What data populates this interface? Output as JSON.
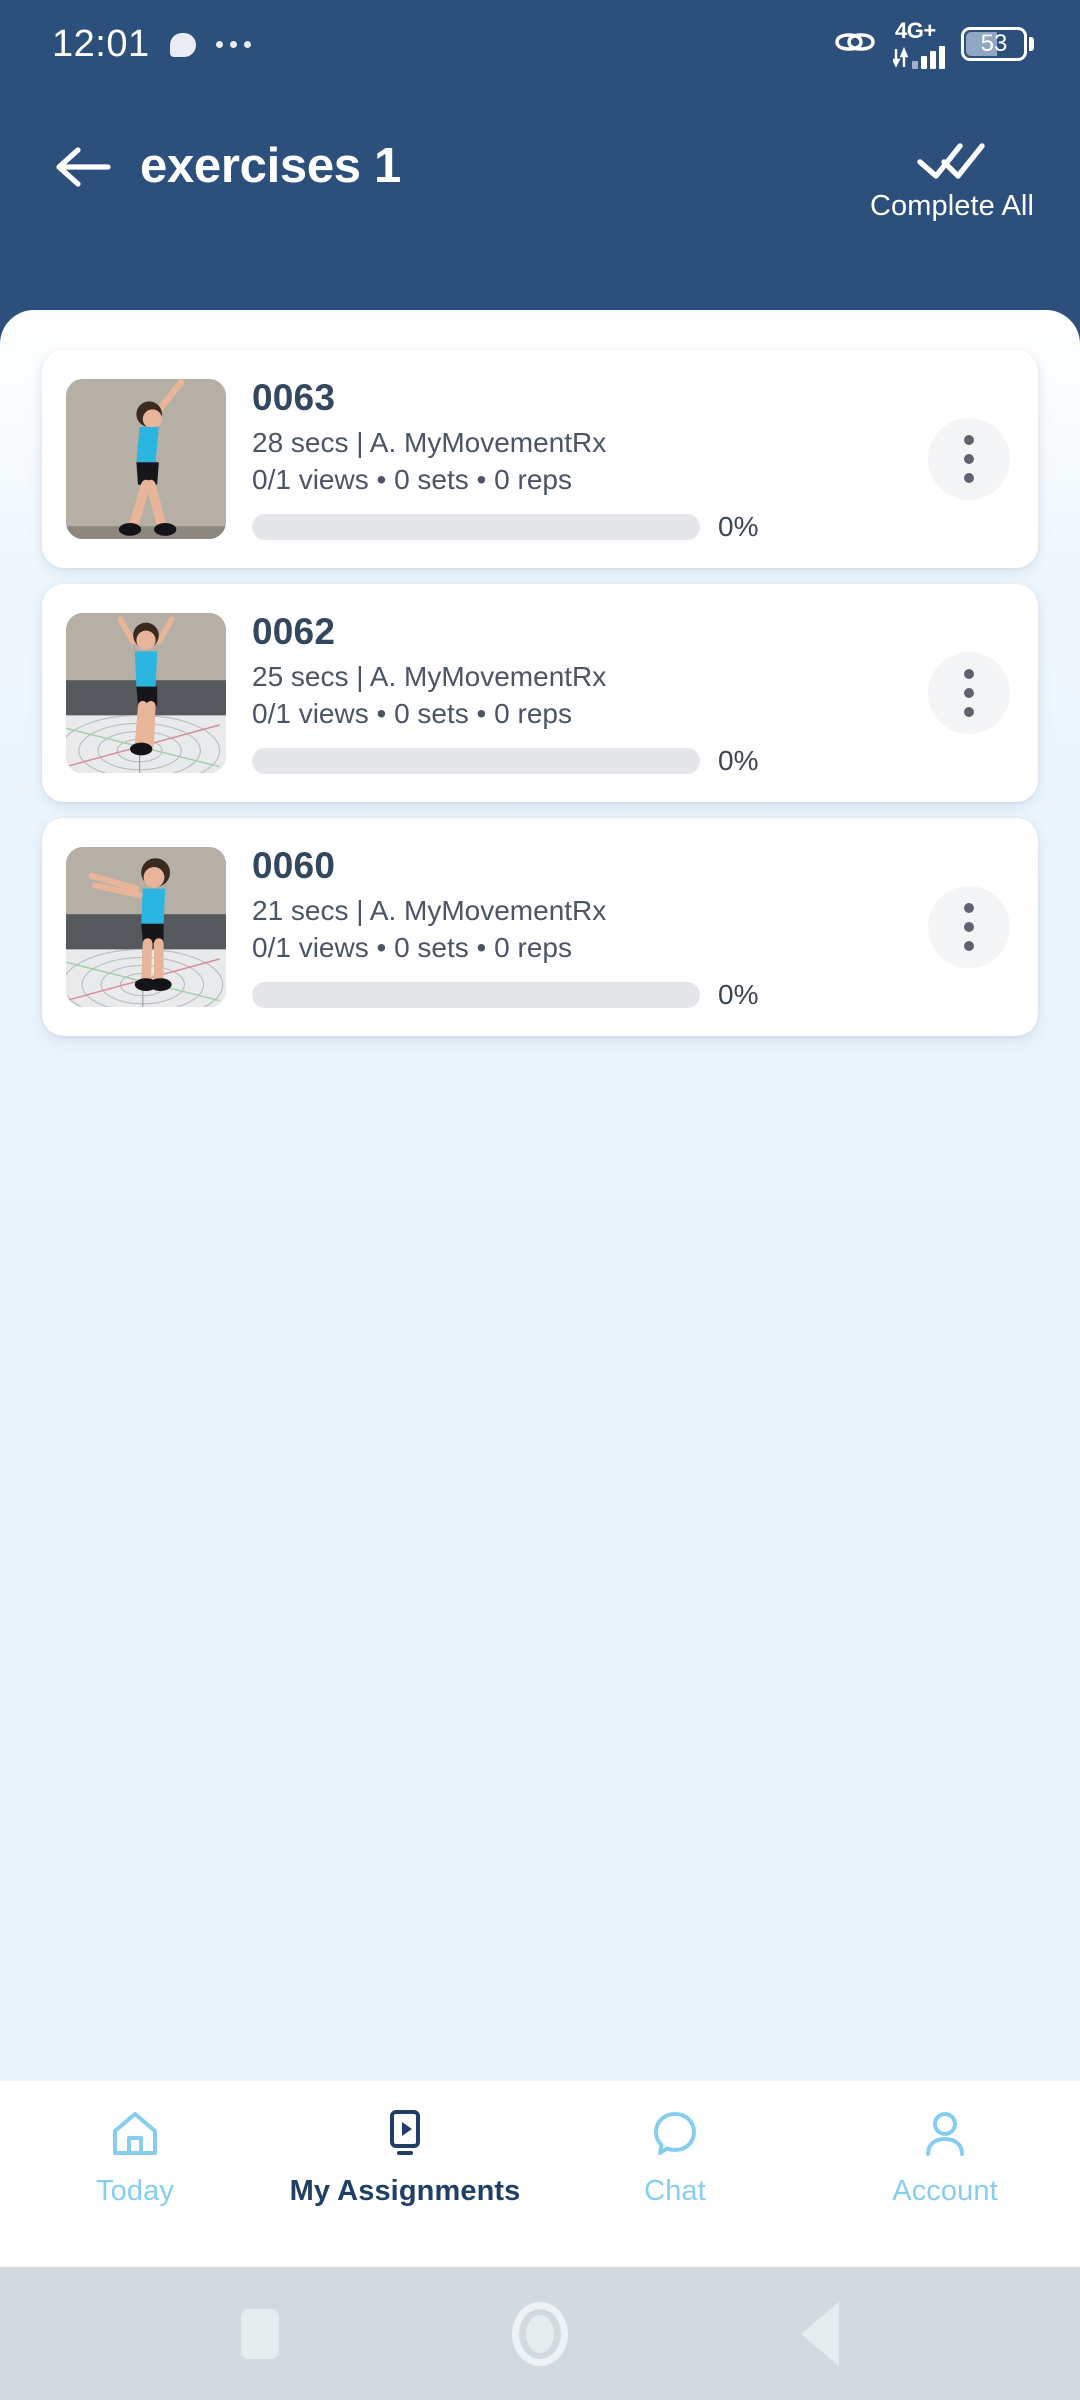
{
  "status_bar": {
    "time": "12:01",
    "bubble_icon": "chat-bubble-icon",
    "overflow_icon": "more-dots-icon",
    "link_icon": "link-icon",
    "network_label": "4G+",
    "signal_icon": "signal-bars-icon",
    "battery_level": "53"
  },
  "header": {
    "back_icon": "arrow-left-icon",
    "title": "exercises 1",
    "complete_all_icon": "double-check-icon",
    "complete_all_label": "Complete All",
    "bg_color": "#2d4f7c"
  },
  "exercises": [
    {
      "title": "0063",
      "meta": "28 secs | A. MyMovementRx",
      "stats": "0/1 views • 0 sets • 0 reps",
      "progress_pct": "0%",
      "progress_value": 0,
      "thumbnail": "exercise-thumbnail-0063",
      "menu_icon": "kebab-menu-icon"
    },
    {
      "title": "0062",
      "meta": "25 secs | A. MyMovementRx",
      "stats": "0/1 views • 0 sets • 0 reps",
      "progress_pct": "0%",
      "progress_value": 0,
      "thumbnail": "exercise-thumbnail-0062",
      "menu_icon": "kebab-menu-icon"
    },
    {
      "title": "0060",
      "meta": "21 secs | A. MyMovementRx",
      "stats": "0/1 views • 0 sets • 0 reps",
      "progress_pct": "0%",
      "progress_value": 0,
      "thumbnail": "exercise-thumbnail-0060",
      "menu_icon": "kebab-menu-icon"
    }
  ],
  "bottom_nav": {
    "active_index": 1,
    "items": [
      {
        "label": "Today",
        "icon": "home-icon",
        "active": false
      },
      {
        "label": "My Assignments",
        "icon": "video-monitor-icon",
        "active": true
      },
      {
        "label": "Chat",
        "icon": "speech-bubble-icon",
        "active": false
      },
      {
        "label": "Account",
        "icon": "person-icon",
        "active": false
      }
    ],
    "inactive_color": "#86cdf0",
    "active_color": "#213f66"
  },
  "android_nav": {
    "recents_icon": "square-recents-icon",
    "home_icon": "circle-home-icon",
    "back_icon": "triangle-back-icon"
  }
}
